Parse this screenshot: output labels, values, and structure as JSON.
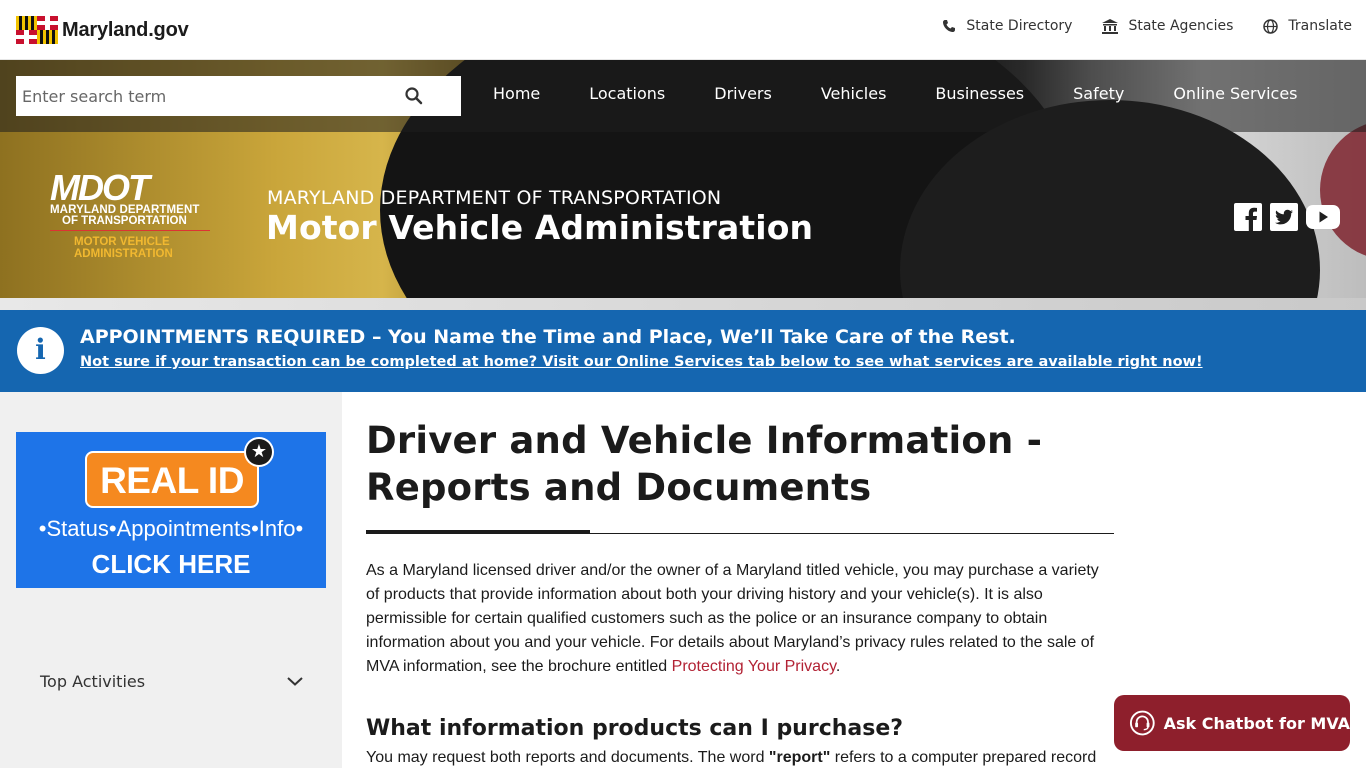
{
  "utility": {
    "logo_text": "Maryland.gov",
    "links": [
      {
        "label": "State Directory",
        "icon": "phone-icon"
      },
      {
        "label": "State Agencies",
        "icon": "building-icon"
      },
      {
        "label": "Translate",
        "icon": "globe-icon"
      }
    ]
  },
  "nav": {
    "search_placeholder": "Enter search term",
    "items": [
      "Home",
      "Locations",
      "Drivers",
      "Vehicles",
      "Businesses",
      "Safety",
      "Online Services"
    ]
  },
  "hero": {
    "logo": {
      "big": "MDOT",
      "line1": "MARYLAND DEPARTMENT",
      "line2": "OF TRANSPORTATION",
      "line3": "MOTOR VEHICLE",
      "line4": "ADMINISTRATION"
    },
    "subtitle": "MARYLAND DEPARTMENT OF TRANSPORTATION",
    "title": "Motor Vehicle Administration",
    "social": [
      "facebook-icon",
      "twitter-icon",
      "youtube-icon"
    ]
  },
  "alert": {
    "title": "APPOINTMENTS REQUIRED – You Name the Time and Place, We’ll Take Care of the Rest.",
    "link": "Not sure if your transaction can be completed at home? Visit our Online Services tab below to see what services are available right now!"
  },
  "sidebar": {
    "realid": {
      "badge": "REAL ID",
      "line1": "•Status•Appointments•Info•",
      "line2": "CLICK HERE"
    },
    "top_activities": "Top Activities"
  },
  "main": {
    "title": "Driver and Vehicle Information - Reports and Documents",
    "para_before_link": "As a Maryland licensed driver and/or the owner of a Maryland titled vehicle, you may purchase a variety of products that provide information about both your driving history and your vehicle(s).  It is also permissible for certain qualified customers such as the police or an insurance company to obtain information about you and your vehicle.  For details about Maryland’s privacy rules related to the sale of MVA information, see the brochure entitled ",
    "para_link": "Protecting Your Privacy",
    "para_after_link": ".",
    "h2": "What information products can I purchase?",
    "para2_start": "You may request both reports and documents. The word ",
    "para2_bold": "\"report\"",
    "para2_end": " refers to a computer prepared record"
  },
  "chatbot": {
    "label": "Ask Chatbot for MVA"
  },
  "colors": {
    "nav_overlay": "#1e1e1e",
    "alert_blue": "#1566b0",
    "link_red": "#b22234",
    "chatbot": "#8e1f2c",
    "realid_blue": "#1e74e8",
    "realid_orange": "#f5891f",
    "gold": "#f1b830"
  }
}
